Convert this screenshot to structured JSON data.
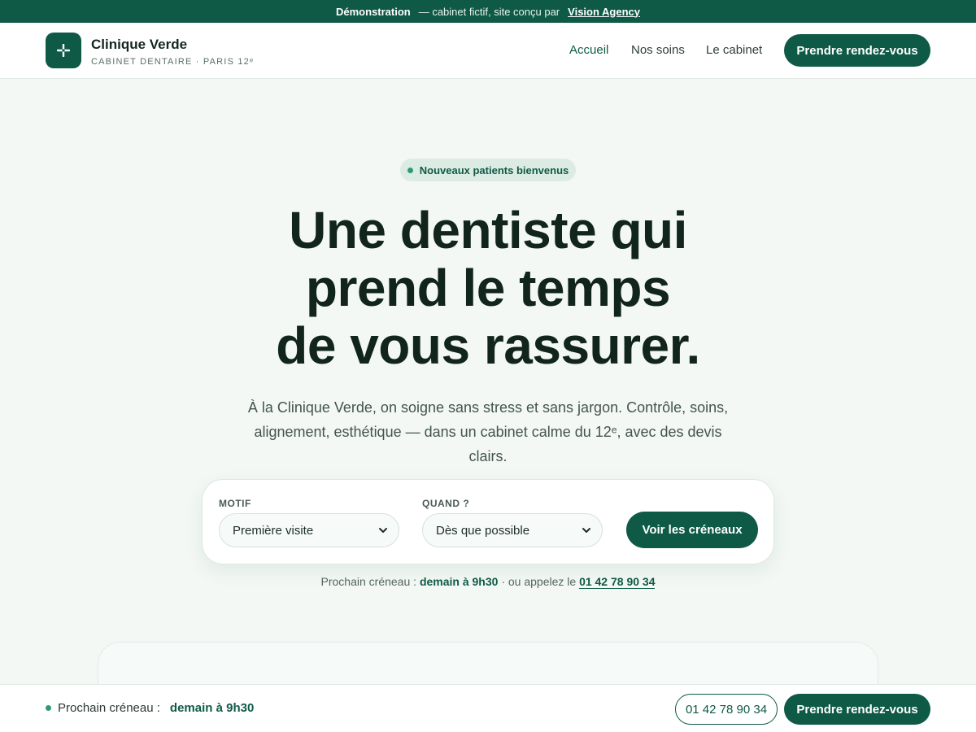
{
  "demo_banner": {
    "label": "Démonstration",
    "text": "— cabinet fictif, site conçu par",
    "agency": "Vision Agency"
  },
  "header": {
    "brand_name": "Clinique Verde",
    "brand_sub": "CABINET DENTAIRE · PARIS 12ᵉ",
    "logo_icon": "cross-plus-icon",
    "nav": [
      {
        "label": "Accueil",
        "active": true
      },
      {
        "label": "Nos soins",
        "active": false
      },
      {
        "label": "Le cabinet",
        "active": false
      }
    ],
    "cta_label": "Prendre rendez-vous"
  },
  "hero": {
    "pill": "Nouveaux patients bienvenus",
    "title_lines": [
      "Une dentiste qui",
      "prend le temps",
      "de vous rassurer."
    ],
    "description": "À la Clinique Verde, on soigne sans stress et sans jargon. Contrôle, soins, alignement, esthétique — dans un cabinet calme du 12ᵉ, avec des devis clairs."
  },
  "booking": {
    "motif_label": "MOTIF",
    "motif_value": "Première visite",
    "quand_label": "QUAND ?",
    "quand_value": "Dès que possible",
    "cta_label": "Voir les créneaux"
  },
  "next_slot": {
    "prefix": "Prochain créneau :",
    "slot": "demain à 9h30",
    "middle": "· ou appelez le",
    "phone": "01 42 78 90 34"
  },
  "bottom_bar": {
    "slot_prefix": "Prochain créneau :",
    "slot": "demain à 9h30",
    "phone": "01 42 78 90 34",
    "cta_label": "Prendre rendez-vous"
  },
  "colors": {
    "brand": "#0f5a46",
    "background": "#f3f8f5",
    "accent_dot": "#2f9b74"
  }
}
